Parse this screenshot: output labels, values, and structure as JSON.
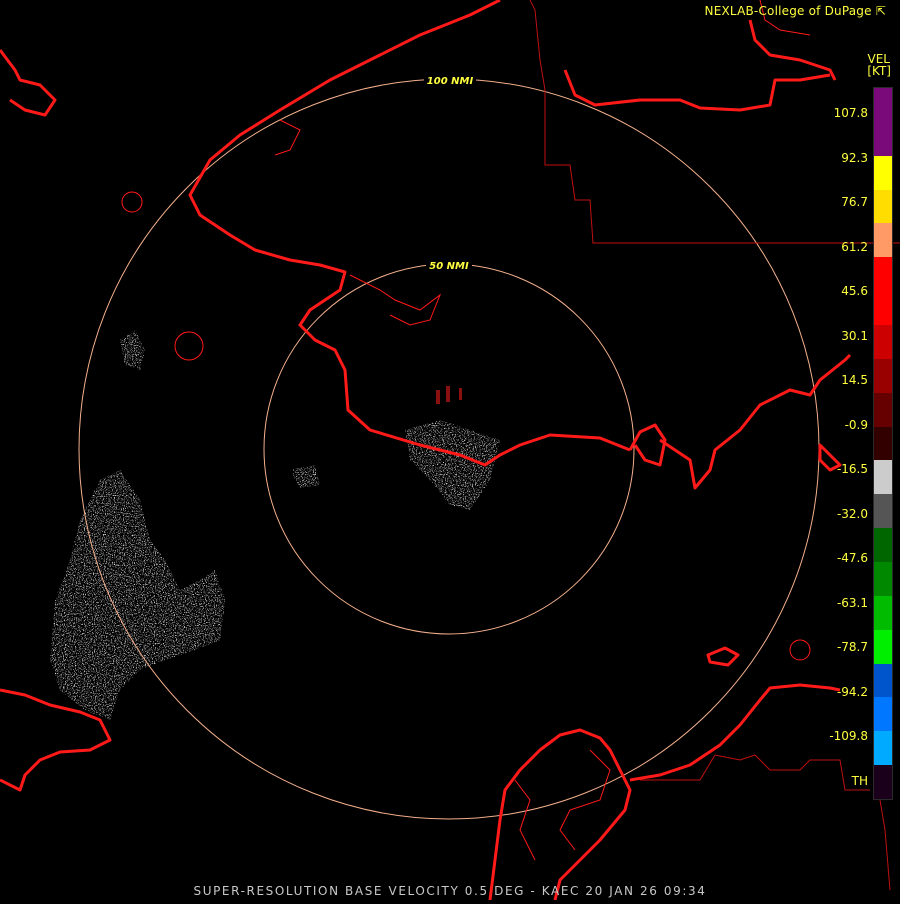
{
  "credit": "NEXLAB-College of DuPage",
  "credit_icon": "external-link-icon",
  "legend": {
    "title": "VEL",
    "unit": "[KT]",
    "labels": [
      "107.8",
      "92.3",
      "76.7",
      "61.2",
      "45.6",
      "30.1",
      "14.5",
      "-0.9",
      "-16.5",
      "-32.0",
      "-47.6",
      "-63.1",
      "-78.7",
      "-94.2",
      "-109.8",
      "TH"
    ],
    "colors": [
      "#7a0a7a",
      "#7a0a7a",
      "#ffff00",
      "#ffdd00",
      "#ff9966",
      "#ff0000",
      "#ff0000",
      "#cc0000",
      "#990000",
      "#660000",
      "#330000",
      "#cccccc",
      "#555555",
      "#006600",
      "#008800",
      "#00bb00",
      "#00ee00",
      "#0055cc",
      "#0077ff",
      "#00aaff",
      "#1a001a"
    ]
  },
  "range_rings": [
    "100 NMI",
    "50 NMI"
  ],
  "footer": "SUPER-RESOLUTION BASE VELOCITY 0.5 DEG - KAEC 20 JAN 26 09:34",
  "colors": {
    "coastline": "#ff1a1a",
    "ring": "#f4b08c",
    "text": "#ffff40",
    "background": "#000000"
  }
}
